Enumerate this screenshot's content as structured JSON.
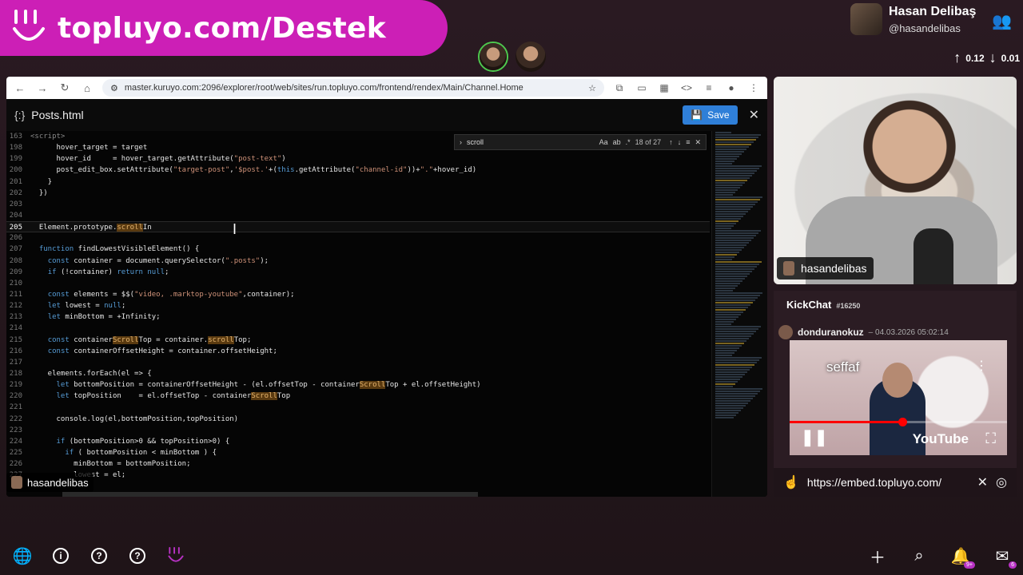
{
  "banner": {
    "text": "topluyo.com/Destek"
  },
  "profile": {
    "name": "Hasan Delibaş",
    "handle": "@hasandelibas"
  },
  "network": {
    "up": "0.12",
    "down": "0.01"
  },
  "browser": {
    "url": "master.kuruyo.com:2096/explorer/root/web/sites/run.topluyo.com/frontend/rendex/Main/Channel.Home"
  },
  "editor": {
    "filename": "Posts.html",
    "save_label": "Save",
    "find": {
      "term": "scroll",
      "count": "18 of 27",
      "aa": "Aa",
      "ab": "ab"
    },
    "lines": [
      {
        "n": "163",
        "html": "<span class=\"grey\">&lt;script&gt;</span>"
      },
      {
        "n": "198",
        "html": "      hover_target = target"
      },
      {
        "n": "199",
        "html": "      hover_id     = hover_target.getAttribute(<span class=\"str\">\"post-text\"</span>)"
      },
      {
        "n": "200",
        "html": "      post_edit_box.setAttribute(<span class=\"str\">\"target-post\"</span>,<span class=\"str\">'$post.'</span>+(<span class=\"kw\">this</span>.getAttribute(<span class=\"str\">\"channel-id\"</span>))+<span class=\"str\">\".\"</span>+hover_id)"
      },
      {
        "n": "201",
        "html": "    }"
      },
      {
        "n": "202",
        "html": "  })"
      },
      {
        "n": "203",
        "html": ""
      },
      {
        "n": "204",
        "html": ""
      },
      {
        "n": "205",
        "html": "  Element.prototype.<span class=\"hl\">scroll</span>In",
        "current": true
      },
      {
        "n": "206",
        "html": ""
      },
      {
        "n": "207",
        "html": "  <span class=\"kw\">function</span> findLowestVisibleElement() {"
      },
      {
        "n": "208",
        "html": "    <span class=\"kw\">const</span> container = document.querySelector(<span class=\"str\">\".posts\"</span>);"
      },
      {
        "n": "209",
        "html": "    <span class=\"kw\">if</span> (!container) <span class=\"kw\">return null</span>;"
      },
      {
        "n": "210",
        "html": ""
      },
      {
        "n": "211",
        "html": "    <span class=\"kw\">const</span> elements = $$(<span class=\"str\">\"video, .marktop-youtube\"</span>,container);"
      },
      {
        "n": "212",
        "html": "    <span class=\"kw\">let</span> lowest = <span class=\"kw\">null</span>;"
      },
      {
        "n": "213",
        "html": "    <span class=\"kw\">let</span> minBottom = +Infinity;"
      },
      {
        "n": "214",
        "html": ""
      },
      {
        "n": "215",
        "html": "    <span class=\"kw\">const</span> container<span class=\"hl\">Scroll</span>Top = container.<span class=\"hl\">scroll</span>Top;"
      },
      {
        "n": "216",
        "html": "    <span class=\"kw\">const</span> containerOffsetHeight = container.offsetHeight;"
      },
      {
        "n": "217",
        "html": ""
      },
      {
        "n": "218",
        "html": "    elements.forEach(el =&gt; {"
      },
      {
        "n": "219",
        "html": "      <span class=\"kw\">let</span> bottomPosition = containerOffsetHeight - (el.offsetTop - container<span class=\"hl\">Scroll</span>Top + el.offsetHeight)"
      },
      {
        "n": "220",
        "html": "      <span class=\"kw\">let</span> topPosition    = el.offsetTop - container<span class=\"hl\">Scroll</span>Top"
      },
      {
        "n": "221",
        "html": ""
      },
      {
        "n": "222",
        "html": "      console.log(el,bottomPosition,topPosition)"
      },
      {
        "n": "223",
        "html": ""
      },
      {
        "n": "224",
        "html": "      <span class=\"kw\">if</span> (bottomPosition&gt;0 &amp;&amp; topPosition&gt;0) {"
      },
      {
        "n": "225",
        "html": "        <span class=\"kw\">if</span> ( bottomPosition &lt; minBottom ) {"
      },
      {
        "n": "226",
        "html": "          minBottom = bottomPosition;"
      },
      {
        "n": "227",
        "html": "          lowest = el;"
      }
    ]
  },
  "overlay_user": "hasandelibas",
  "webcam": {
    "username": "hasandelibas"
  },
  "chat": {
    "title": "KickChat",
    "id": "#16250",
    "message": {
      "user": "donduranokuz",
      "time": "– 04.03.2026 05:02:14"
    },
    "video": {
      "title": "seffaf",
      "brand": "YouTube",
      "progress_pct": 52
    }
  },
  "embed_url": "https://embed.topluyo.com/",
  "notifications": {
    "bell_badge": "9+",
    "mail_badge": "6"
  },
  "colors": {
    "brand": "#cc1fb6",
    "save": "#2f7fd8"
  }
}
